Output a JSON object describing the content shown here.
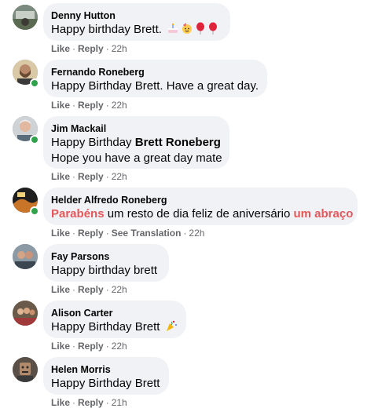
{
  "actions": {
    "like": "Like",
    "reply": "Reply",
    "see_translation": "See Translation",
    "separator": "·"
  },
  "colors": {
    "bubble": "#f0f2f5",
    "meta": "#65676b",
    "online": "#31a24c",
    "highlight": "#e4585b"
  },
  "comments": [
    {
      "author": "Denny Hutton",
      "text": "Happy birthday Brett.",
      "emoji": [
        "cake-icon",
        "party-face-icon",
        "balloon-icon",
        "balloon-icon"
      ],
      "time": "22h",
      "online": false
    },
    {
      "author": "Fernando Roneberg",
      "text": "Happy Birthday Brett. Have a great day.",
      "time": "22h",
      "online": true
    },
    {
      "author": "Jim Mackail",
      "text_prefix": "Happy Birthday ",
      "mention": "Brett Roneberg",
      "text_line2": "Hope you have a great day mate",
      "time": "22h",
      "online": true
    },
    {
      "author": "Helder Alfredo Roneberg",
      "highlight_1": "Parabéns",
      "text_middle": " um resto de dia feliz de aniversário ",
      "highlight_2": "um abraço",
      "time": "22h",
      "online": true
    },
    {
      "author": "Fay Parsons",
      "text": "Happy birthday brett",
      "time": "22h",
      "online": false
    },
    {
      "author": "Alison Carter",
      "text": "Happy Birthday Brett",
      "emoji": [
        "party-popper-icon"
      ],
      "time": "22h",
      "online": false
    },
    {
      "author": "Helen Morris",
      "text": "Happy Birthday Brett",
      "time": "21h",
      "online": false
    }
  ]
}
